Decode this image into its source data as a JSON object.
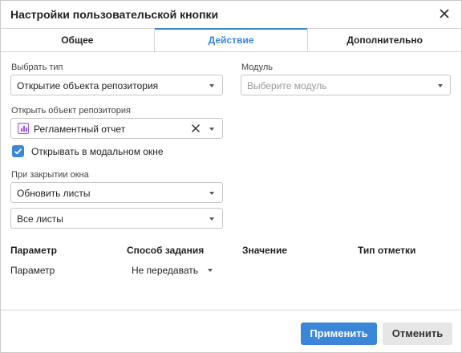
{
  "dialog": {
    "title": "Настройки пользовательской кнопки",
    "close_icon": "close-icon"
  },
  "tabs": [
    {
      "label": "Общее",
      "active": false
    },
    {
      "label": "Действие",
      "active": true
    },
    {
      "label": "Дополнительно",
      "active": false
    }
  ],
  "form": {
    "type_label": "Выбрать тип",
    "type_value": "Открытие объекта репозитория",
    "module_label": "Модуль",
    "module_placeholder": "Выберите модуль",
    "repo_label": "Открыть объект репозитория",
    "repo_value": "Регламентный отчет",
    "repo_icon": "report-icon",
    "modal_checkbox_label": "Открывать в модальном окне",
    "modal_checked": true,
    "on_close_label": "При закрытии окна",
    "on_close_value": "Обновить листы",
    "sheets_value": "Все листы"
  },
  "params_table": {
    "headers": [
      "Параметр",
      "Способ задания",
      "Значение",
      "Тип отметки"
    ],
    "rows": [
      {
        "param": "Параметр",
        "method": "Не передавать"
      }
    ]
  },
  "footer": {
    "apply_label": "Применить",
    "cancel_label": "Отменить"
  },
  "colors": {
    "accent": "#3a86d8",
    "repo_icon": "#9b59d0"
  }
}
